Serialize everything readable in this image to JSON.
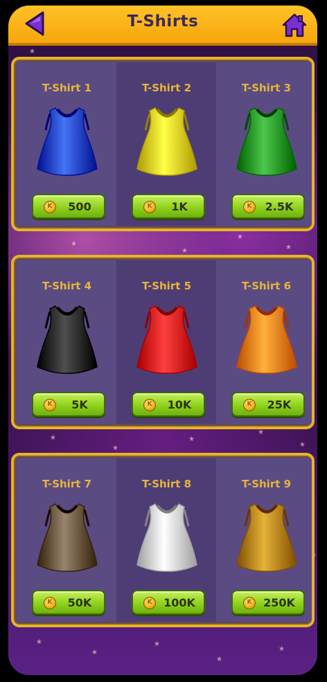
{
  "header": {
    "title": "T-Shirts",
    "back_icon": "back-arrow-icon",
    "home_icon": "home-icon"
  },
  "shop": {
    "currency_icon": "coin-icon",
    "items": [
      {
        "name": "T-Shirt 1",
        "price": "500",
        "color": "#1747c8"
      },
      {
        "name": "T-Shirt 2",
        "price": "1K",
        "color": "#e6d21a"
      },
      {
        "name": "T-Shirt 3",
        "price": "2.5K",
        "color": "#1f9a1f"
      },
      {
        "name": "T-Shirt 4",
        "price": "5K",
        "color": "#222222"
      },
      {
        "name": "T-Shirt 5",
        "price": "10K",
        "color": "#e01212"
      },
      {
        "name": "T-Shirt 6",
        "price": "25K",
        "color": "#f5840f"
      },
      {
        "name": "T-Shirt 7",
        "price": "50K",
        "color": "#6b5840"
      },
      {
        "name": "T-Shirt 8",
        "price": "100K",
        "color": "#d6d6d6"
      },
      {
        "name": "T-Shirt 9",
        "price": "250K",
        "color": "#b8860b"
      }
    ]
  },
  "colors": {
    "header_bg": "#ffc226",
    "title_text": "#3a2a5a",
    "panel_border": "#e5b42a",
    "card_name_text": "#e6b53a",
    "price_button": "#8fd21d",
    "icon_purple": "#7a2fd0"
  }
}
